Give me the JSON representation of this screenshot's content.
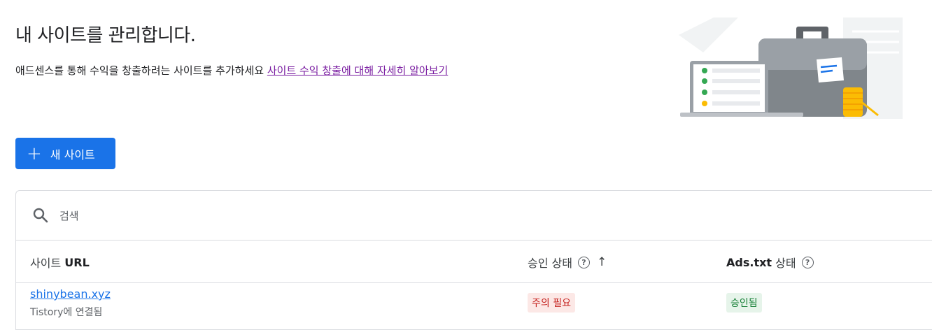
{
  "page": {
    "title": "내 사이트를 관리합니다.",
    "subtitle": "애드센스를 통해 수익을 창출하려는 사이트를 추가하세요",
    "learn_more_link": "사이트 수익 창출에 대해 자세히 알아보기"
  },
  "toolbar": {
    "new_site_label": "새 사이트",
    "new_site_icon": "plus-icon"
  },
  "search": {
    "placeholder": "검색",
    "icon": "search-icon"
  },
  "table": {
    "columns": {
      "site_url_prefix": "사이트",
      "site_url_bold": "URL",
      "approval_status": "승인 상태",
      "ads_txt_prefix": "Ads.txt",
      "ads_txt_suffix": "상태"
    },
    "rows": [
      {
        "site": "shinybean.xyz",
        "connected": "Tistory에 연결됨",
        "approval": "주의 필요",
        "ads_txt": "승인됨"
      }
    ]
  },
  "colors": {
    "primary": "#1a73e8",
    "link_visited": "#7b1fa2",
    "warn_bg": "#fce8e6",
    "warn_text": "#c5221f",
    "ok_bg": "#e6f4ea",
    "ok_text": "#188038"
  }
}
